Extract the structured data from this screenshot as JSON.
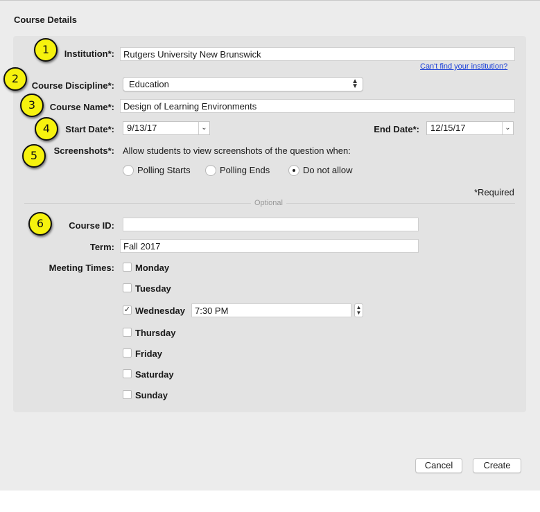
{
  "dialog": {
    "title": "Course Details"
  },
  "callouts": [
    "1",
    "2",
    "3",
    "4",
    "5",
    "6"
  ],
  "institution": {
    "label": "Institution*:",
    "value": "Rutgers University New Brunswick",
    "help_link": "Can't find your institution?"
  },
  "discipline": {
    "label": "Course Discipline*:",
    "value": "Education"
  },
  "course_name": {
    "label": "Course Name*:",
    "value": "Design of Learning Environments"
  },
  "start_date": {
    "label": "Start Date*:",
    "value": "9/13/17"
  },
  "end_date": {
    "label": "End Date*:",
    "value": "12/15/17"
  },
  "screenshots": {
    "label": "Screenshots*:",
    "description": "Allow students to view screenshots of the question when:",
    "options": [
      {
        "label": "Polling Starts",
        "selected": false
      },
      {
        "label": "Polling Ends",
        "selected": false
      },
      {
        "label": "Do not allow",
        "selected": true
      }
    ]
  },
  "required_note": "*Required",
  "optional_label": "Optional",
  "course_id": {
    "label": "Course ID:",
    "value": ""
  },
  "term": {
    "label": "Term:",
    "value": "Fall 2017"
  },
  "meeting_times": {
    "label": "Meeting Times:",
    "days": [
      {
        "label": "Monday",
        "checked": false,
        "check_glyph": ""
      },
      {
        "label": "Tuesday",
        "checked": false,
        "check_glyph": ""
      },
      {
        "label": "Wednesday",
        "checked": true,
        "check_glyph": "✓",
        "time": "7:30 PM"
      },
      {
        "label": "Thursday",
        "checked": false,
        "check_glyph": ""
      },
      {
        "label": "Friday",
        "checked": false,
        "check_glyph": ""
      },
      {
        "label": "Saturday",
        "checked": false,
        "check_glyph": ""
      },
      {
        "label": "Sunday",
        "checked": false,
        "check_glyph": ""
      }
    ]
  },
  "buttons": {
    "cancel": "Cancel",
    "create": "Create"
  },
  "icons": {
    "updown": "updown-arrows-icon",
    "chevron": "chevron-down-icon",
    "check": "checkmark-icon"
  },
  "colors": {
    "callout": "#f6f20e",
    "link": "#1a3fd8",
    "panel": "#e3e3e3",
    "window": "#ececec"
  }
}
